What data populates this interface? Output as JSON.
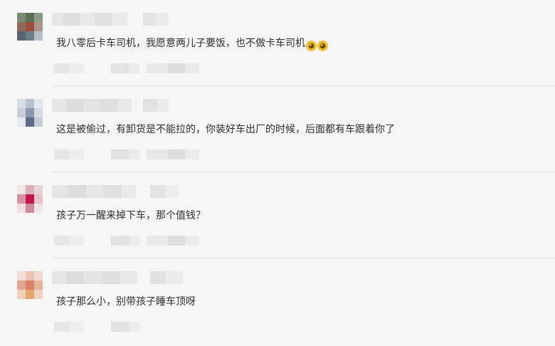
{
  "comments": [
    {
      "text": "我八零后卡车司机，我愿意两儿子要饭，也不做卡车司机",
      "emoji": [
        "crying-face",
        "crying-face"
      ],
      "avatar_colors": [
        "#7a8a77",
        "#5f6f55",
        "#8b9c86",
        "#f6f6f6",
        "#8d6a5b",
        "#9b4f3c",
        "#a99589",
        "#f6f6f6",
        "#5a6470",
        "#6e7d8a",
        "#b7bec5",
        "#f6f6f6"
      ]
    },
    {
      "text": "这是被偷过，有卸货是不能拉的，你装好车出厂的时候，后面都有车跟着你了",
      "emoji": [],
      "avatar_colors": [
        "#d7dde6",
        "#b9c2cf",
        "#e3e7ee",
        "#f6f6f6",
        "#c7ced9",
        "#8c98ad",
        "#d4d9e2",
        "#f6f6f6",
        "#e7e9ee",
        "#5f6b85",
        "#c5cbd6",
        "#f6f6f6"
      ]
    },
    {
      "text": "孩子万一醒来掉下车，那个值钱？",
      "emoji": [],
      "avatar_colors": [
        "#f0e5e7",
        "#d9b0ba",
        "#e8d4d8",
        "#f6f6f6",
        "#d790a4",
        "#c2184f",
        "#e3c3cc",
        "#f6f6f6",
        "#eedde1",
        "#c98b9c",
        "#efe4e7",
        "#f6f6f6"
      ]
    },
    {
      "text": "孩子那么小，别带孩子睡车顶呀",
      "emoji": [],
      "avatar_colors": [
        "#f3ded7",
        "#e9c3b5",
        "#f1d9d1",
        "#f6f6f6",
        "#e0a58e",
        "#d9836b",
        "#e6b49d",
        "#f6f6f6",
        "#f0cdb9",
        "#e2a96f",
        "#f0d2c2",
        "#f6f6f6"
      ]
    }
  ]
}
